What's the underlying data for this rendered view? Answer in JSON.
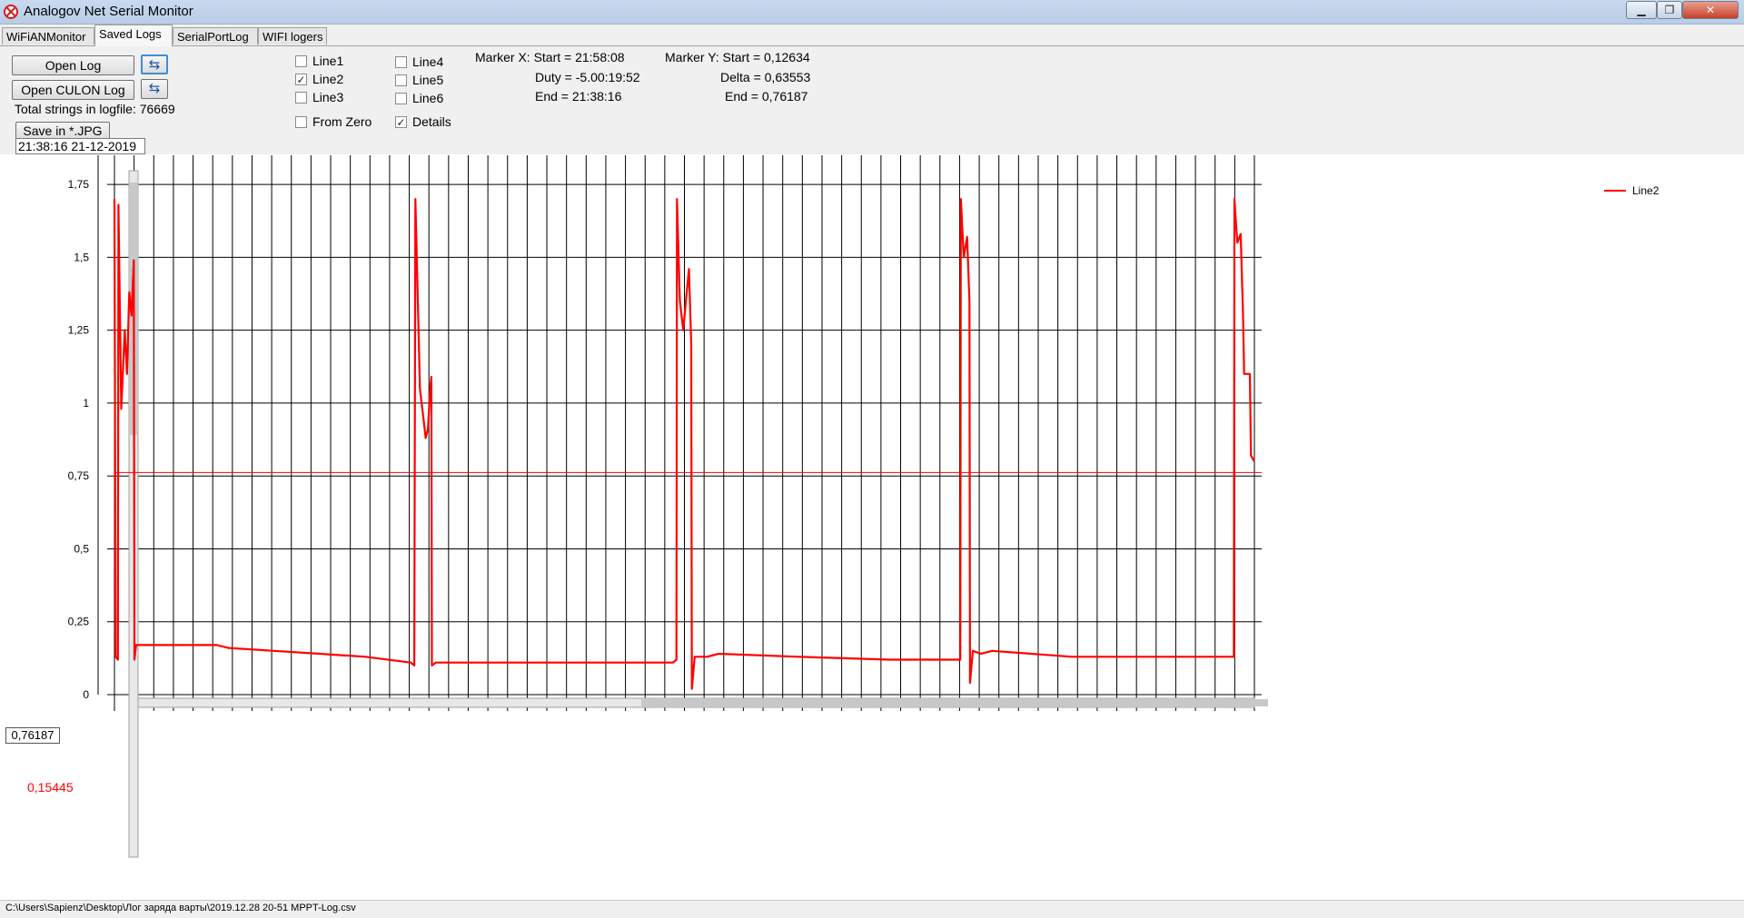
{
  "window": {
    "title": "Analogov Net Serial Monitor",
    "controls": {
      "minimize": "▁",
      "maximize": "❐",
      "close": "✕"
    }
  },
  "tabs": [
    "WiFiANMonitor",
    "Saved Logs",
    "SerialPortLog",
    "WIFI logers"
  ],
  "active_tab": "Saved Logs",
  "toolbar": {
    "open_log": "Open Log",
    "open_culon_log": "Open CULON Log",
    "refresh_icon": "refresh-icon",
    "total_strings": "Total strings in logfile: 76669",
    "save_jpg": "Save in *.JPG",
    "timestamp": "21:38:16 21-12-2019"
  },
  "checkboxes": {
    "line1": {
      "label": "Line1",
      "checked": false
    },
    "line2": {
      "label": "Line2",
      "checked": true
    },
    "line3": {
      "label": "Line3",
      "checked": false
    },
    "line4": {
      "label": "Line4",
      "checked": false
    },
    "line5": {
      "label": "Line5",
      "checked": false
    },
    "line6": {
      "label": "Line6",
      "checked": false
    },
    "from_zero": {
      "label": "From Zero",
      "checked": false
    },
    "details": {
      "label": "Details",
      "checked": true
    }
  },
  "marker_x": {
    "start": "Marker X: Start = 21:58:08",
    "duty": "Duty = -5.00:19:52",
    "end": "End  = 21:38:16"
  },
  "marker_y": {
    "start": "Marker Y: Start = 0,12634",
    "delta": "Delta = 0,63553",
    "end": "End  = 0,76187"
  },
  "cursor": {
    "value_box": "0,76187",
    "red_value": "0,15445"
  },
  "status": {
    "path": "C:\\Users\\Sapienz\\Desktop\\Лог заряда варты\\2019.12.28 20-51 MPPT-Log.csv"
  },
  "colors": {
    "series": "#ff0000",
    "grid": "#000000",
    "marker": "#ff0000",
    "accent": "#3c8fd8"
  },
  "chart_data": {
    "type": "line",
    "ylim": [
      0,
      1.85
    ],
    "yticks": [
      0,
      0.25,
      0.5,
      0.75,
      1,
      1.25,
      1.5,
      1.75
    ],
    "ytick_labels": [
      "0",
      "0,25",
      "0,5",
      "0,75",
      "1",
      "1,25",
      "1,5",
      "1,75"
    ],
    "xlim": [
      0,
      100
    ],
    "grid_vertical_count": 59,
    "grid": true,
    "legend_position": "top-right",
    "marker_y_values": [
      0.76187,
      0.76187
    ],
    "series": [
      {
        "name": "Line2",
        "color": "#ff0000",
        "points": [
          [
            0.0,
            1.7
          ],
          [
            0.1,
            0.13
          ],
          [
            0.3,
            0.12
          ],
          [
            0.35,
            1.68
          ],
          [
            0.6,
            0.98
          ],
          [
            0.9,
            1.25
          ],
          [
            1.1,
            1.1
          ],
          [
            1.3,
            1.38
          ],
          [
            1.5,
            1.3
          ],
          [
            1.7,
            1.49
          ],
          [
            1.75,
            0.12
          ],
          [
            1.9,
            0.17
          ],
          [
            5,
            0.17
          ],
          [
            9,
            0.17
          ],
          [
            10,
            0.16
          ],
          [
            14,
            0.15
          ],
          [
            18,
            0.14
          ],
          [
            22,
            0.13
          ],
          [
            26,
            0.11
          ],
          [
            26.3,
            0.1
          ],
          [
            26.4,
            1.7
          ],
          [
            26.8,
            1.05
          ],
          [
            27.1,
            0.95
          ],
          [
            27.3,
            0.88
          ],
          [
            27.5,
            0.91
          ],
          [
            27.7,
            1.05
          ],
          [
            27.8,
            1.09
          ],
          [
            27.85,
            0.1
          ],
          [
            28.2,
            0.11
          ],
          [
            33,
            0.11
          ],
          [
            38,
            0.11
          ],
          [
            45,
            0.11
          ],
          [
            49,
            0.11
          ],
          [
            49.3,
            0.12
          ],
          [
            49.35,
            1.7
          ],
          [
            49.6,
            1.35
          ],
          [
            49.9,
            1.25
          ],
          [
            50.2,
            1.38
          ],
          [
            50.4,
            1.46
          ],
          [
            50.6,
            1.2
          ],
          [
            50.65,
            0.02
          ],
          [
            50.9,
            0.13
          ],
          [
            52,
            0.13
          ],
          [
            53,
            0.14
          ],
          [
            60,
            0.13
          ],
          [
            68,
            0.12
          ],
          [
            73,
            0.12
          ],
          [
            74.2,
            0.12
          ],
          [
            74.25,
            1.7
          ],
          [
            74.5,
            1.5
          ],
          [
            74.8,
            1.57
          ],
          [
            75.0,
            1.35
          ],
          [
            75.05,
            0.04
          ],
          [
            75.3,
            0.15
          ],
          [
            76,
            0.14
          ],
          [
            77,
            0.15
          ],
          [
            84,
            0.13
          ],
          [
            90,
            0.13
          ],
          [
            98,
            0.13
          ],
          [
            98.2,
            0.13
          ],
          [
            98.25,
            1.7
          ],
          [
            98.5,
            1.55
          ],
          [
            98.8,
            1.58
          ],
          [
            99.0,
            1.3
          ],
          [
            99.1,
            1.1
          ],
          [
            99.6,
            1.1
          ],
          [
            99.7,
            0.82
          ],
          [
            99.85,
            0.81
          ],
          [
            100,
            0.8
          ]
        ]
      }
    ]
  }
}
